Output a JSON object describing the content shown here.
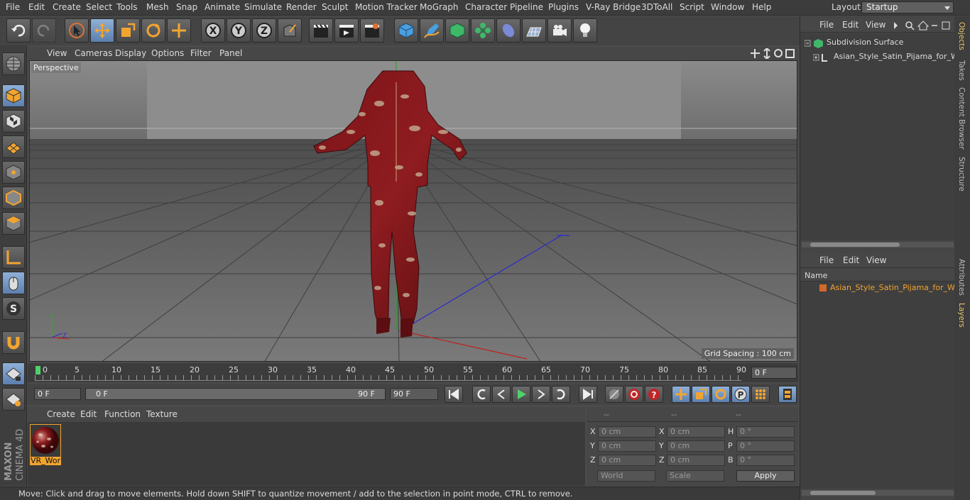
{
  "menubar": {
    "items": [
      "File",
      "Edit",
      "Create",
      "Select",
      "Tools",
      "Mesh",
      "Snap",
      "Animate",
      "Simulate",
      "Render",
      "Sculpt",
      "Motion Tracker",
      "MoGraph",
      "Character",
      "Pipeline",
      "Plugins",
      "V-Ray Bridge",
      "3DToAll",
      "Script",
      "Window",
      "Help"
    ],
    "layout_label": "Layout:",
    "layout_value": "Startup"
  },
  "viewport": {
    "menu": [
      "View",
      "Cameras",
      "Display",
      "Options",
      "Filter",
      "Panel"
    ],
    "label": "Perspective",
    "grid_spacing": "Grid Spacing : 100 cm"
  },
  "timeline": {
    "ticks": [
      "0",
      "5",
      "10",
      "15",
      "20",
      "25",
      "30",
      "35",
      "40",
      "45",
      "50",
      "55",
      "60",
      "65",
      "70",
      "75",
      "80",
      "85",
      "90"
    ],
    "current_frame": "0 F"
  },
  "transport": {
    "start": "0 F",
    "range_start": "0 F",
    "range_end": "90 F",
    "end": "90 F"
  },
  "materials": {
    "menu": [
      "Create",
      "Edit",
      "Function",
      "Texture"
    ],
    "material_name": "VR_Wor"
  },
  "coords": {
    "headers": [
      "--",
      "--",
      "--"
    ],
    "rows": [
      {
        "a": "X",
        "av": "0 cm",
        "b": "X",
        "bv": "0 cm",
        "c": "H",
        "cv": "0 °"
      },
      {
        "a": "Y",
        "av": "0 cm",
        "b": "Y",
        "bv": "0 cm",
        "c": "P",
        "cv": "0 °"
      },
      {
        "a": "Z",
        "av": "0 cm",
        "b": "Z",
        "bv": "0 cm",
        "c": "B",
        "cv": "0 °"
      }
    ],
    "world": "World",
    "scale": "Scale",
    "apply": "Apply"
  },
  "status": "Move: Click and drag to move elements. Hold down SHIFT to quantize movement / add to the selection in point mode, CTRL to remove.",
  "objects": {
    "menu": [
      "File",
      "Edit",
      "View"
    ],
    "items": [
      "Subdivision Surface",
      "Asian_Style_Satin_Pijama_for_Wo"
    ]
  },
  "layers": {
    "menu": [
      "File",
      "Edit",
      "View"
    ],
    "col_name": "Name",
    "item": "Asian_Style_Satin_Pijama_for_Wor"
  },
  "vtabs": [
    "Objects",
    "Takes",
    "Content Browser",
    "Structure",
    "Attributes",
    "Layers"
  ],
  "logo": {
    "line1": "MAXON",
    "line2": "CINEMA 4D"
  },
  "colors": {
    "accent": "#f2a431",
    "selection": "#7a9ccc",
    "material": "#8b1a1f"
  }
}
